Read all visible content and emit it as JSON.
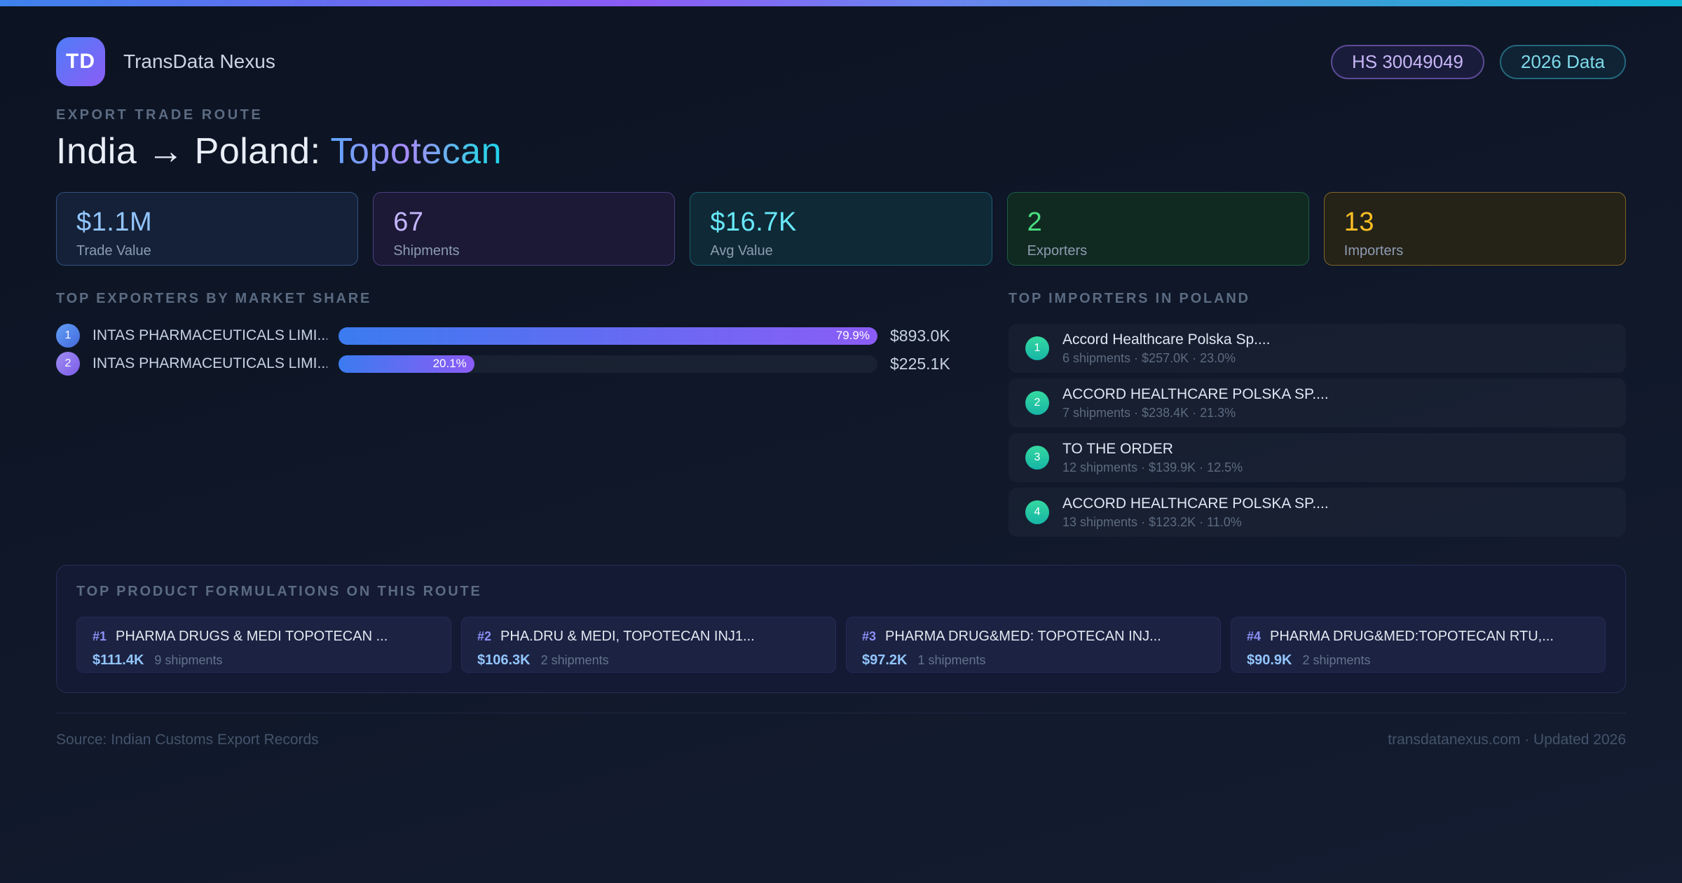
{
  "brand": {
    "logo": "TD",
    "name": "TransData Nexus"
  },
  "header_badges": {
    "hs_code": "HS 30049049",
    "data_year": "2026 Data"
  },
  "eyebrow": "EXPORT TRADE ROUTE",
  "title": {
    "route": "India → Poland: ",
    "product": "Topotecan"
  },
  "stats": [
    {
      "value": "$1.1M",
      "label": "Trade Value",
      "accent": "#93c5fd"
    },
    {
      "value": "67",
      "label": "Shipments",
      "accent": "#c4b5fd"
    },
    {
      "value": "$16.7K",
      "label": "Avg Value",
      "accent": "#67e8f9"
    },
    {
      "value": "2",
      "label": "Exporters",
      "accent": "#4ade80"
    },
    {
      "value": "13",
      "label": "Importers",
      "accent": "#fbbf24"
    }
  ],
  "exporters": {
    "heading": "TOP EXPORTERS BY MARKET SHARE",
    "rows": [
      {
        "rank": "1",
        "name": "INTAS PHARMACEUTICALS LIMI...",
        "share_label": "79.9%",
        "share_pct": 79.9,
        "bar_pct": 100,
        "value": "$893.0K"
      },
      {
        "rank": "2",
        "name": "INTAS PHARMACEUTICALS LIMI...",
        "share_label": "20.1%",
        "share_pct": 20.1,
        "bar_pct": 25.2,
        "value": "$225.1K"
      }
    ]
  },
  "importers": {
    "heading": "TOP IMPORTERS IN POLAND",
    "items": [
      {
        "rank": "1",
        "name": "Accord Healthcare Polska Sp....",
        "meta": "6 shipments · $257.0K · 23.0%"
      },
      {
        "rank": "2",
        "name": "ACCORD HEALTHCARE POLSKA SP....",
        "meta": "7 shipments · $238.4K · 21.3%"
      },
      {
        "rank": "3",
        "name": "TO THE ORDER",
        "meta": "12 shipments · $139.9K · 12.5%"
      },
      {
        "rank": "4",
        "name": "ACCORD HEALTHCARE POLSKA SP....",
        "meta": "13 shipments · $123.2K · 11.0%"
      }
    ]
  },
  "products": {
    "heading": "TOP PRODUCT FORMULATIONS ON THIS ROUTE",
    "cards": [
      {
        "rank": "#1",
        "name": "PHARMA DRUGS & MEDI TOPOTECAN ...",
        "value": "$111.4K",
        "shipments": "9 shipments"
      },
      {
        "rank": "#2",
        "name": "PHA.DRU & MEDI, TOPOTECAN INJ1...",
        "value": "$106.3K",
        "shipments": "2 shipments"
      },
      {
        "rank": "#3",
        "name": "PHARMA DRUG&MED: TOPOTECAN INJ...",
        "value": "$97.2K",
        "shipments": "1 shipments"
      },
      {
        "rank": "#4",
        "name": "PHARMA DRUG&MED:TOPOTECAN RTU,...",
        "value": "$90.9K",
        "shipments": "2 shipments"
      }
    ]
  },
  "footer": {
    "source": "Source: Indian Customs Export Records",
    "site": "transdatanexus.com · Updated 2026"
  },
  "colors": {
    "accent_blue": "#3b7bf0",
    "accent_purple": "#8b5cf6",
    "accent_cyan": "#22d3ee",
    "accent_teal": "#16b5a6",
    "accent_green": "#4ade80",
    "accent_amber": "#fbbf24"
  }
}
